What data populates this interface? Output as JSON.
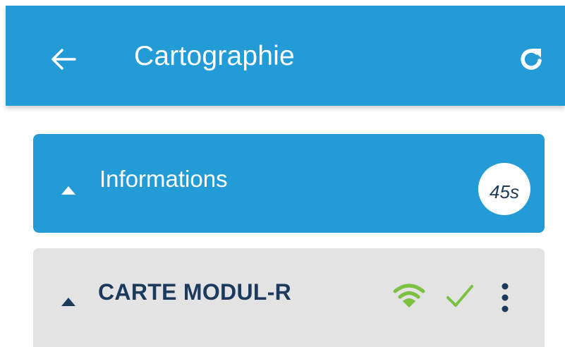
{
  "header": {
    "title": "Cartographie",
    "back_icon": "arrow-left-icon",
    "refresh_icon": "refresh-icon",
    "background_color": "#239bd6"
  },
  "info_section": {
    "title": "Informations",
    "timer": "45s",
    "expanded": true,
    "background_color": "#239bd6"
  },
  "module_section": {
    "title": "CARTE MODUL-R",
    "expanded": true,
    "status_icons": [
      "wifi-icon",
      "check-icon"
    ],
    "menu_icon": "more-vertical-icon",
    "status_color": "#7bc142",
    "background_color": "#e3e3e3"
  }
}
